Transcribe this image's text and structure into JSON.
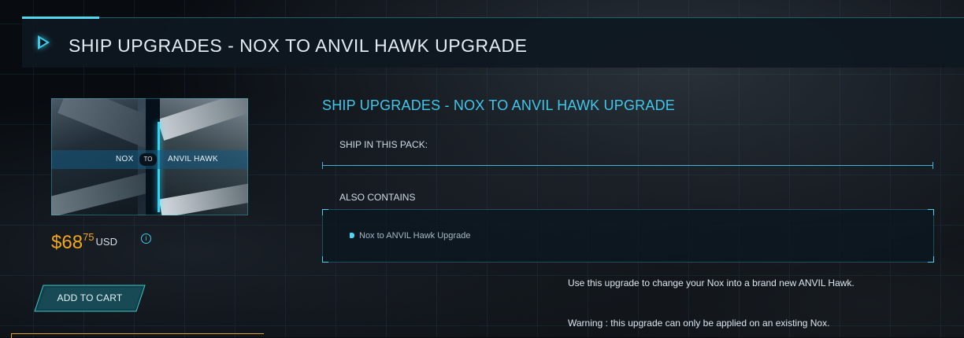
{
  "header": {
    "title": "SHIP UPGRADES - NOX TO ANVIL HAWK UPGRADE"
  },
  "product_image": {
    "from_label": "NOX",
    "to_label": "TO",
    "target_label": "ANVIL HAWK"
  },
  "price": {
    "symbol": "$",
    "whole": "68",
    "cents": "75",
    "currency": "USD"
  },
  "cart": {
    "add_label": "ADD TO CART"
  },
  "details": {
    "title": "SHIP UPGRADES - NOX TO ANVIL HAWK UPGRADE",
    "ship_label": "SHIP IN THIS PACK:",
    "also_label": "ALSO CONTAINS",
    "also_items": [
      "Nox to ANVIL Hawk Upgrade"
    ],
    "description": "Use this upgrade to change your Nox into a brand new ANVIL Hawk.",
    "warning": "Warning : this upgrade can only be applied on an existing Nox."
  },
  "colors": {
    "accent": "#3fc8ea",
    "price": "#f3a818"
  },
  "icons": {
    "header": "play-triangle-icon",
    "info": "info-icon",
    "bullet": "bullet-icon"
  }
}
